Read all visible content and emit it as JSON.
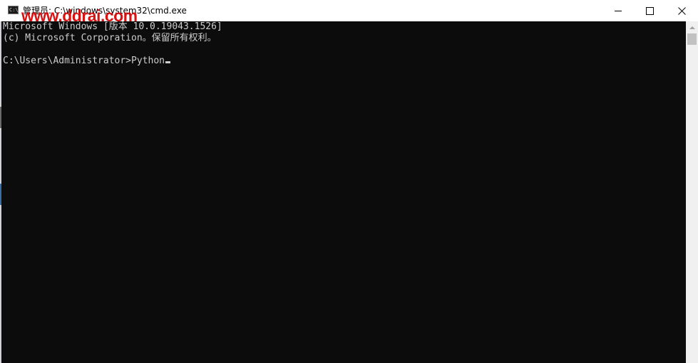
{
  "window": {
    "title": "管理员: C:\\windows\\system32\\cmd.exe",
    "watermark": "www.ddrai.com"
  },
  "controls": {
    "minimize_icon": "minimize-icon",
    "maximize_icon": "maximize-icon",
    "close_label": "✕"
  },
  "console": {
    "line1": "Microsoft Windows [版本 10.0.19043.1526]",
    "line2": "(c) Microsoft Corporation。保留所有权利。",
    "prompt": "C:\\Users\\Administrator>",
    "input": "Python"
  },
  "colors": {
    "console_bg": "#0c0c0c",
    "console_text": "#cccccc",
    "watermark": "#d40000"
  }
}
